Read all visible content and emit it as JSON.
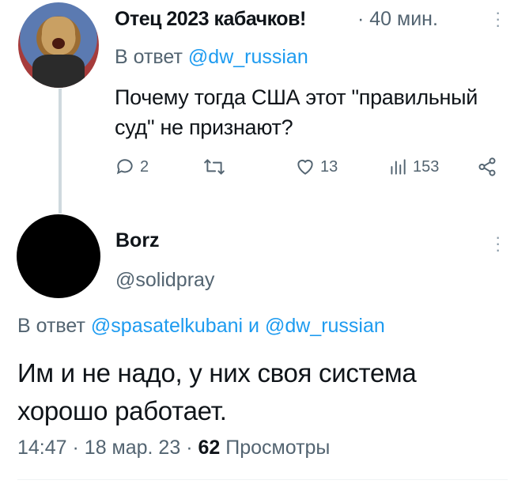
{
  "colors": {
    "accent": "#1d9bf0",
    "secondary": "#536471",
    "text": "#0f1419"
  },
  "tweet1": {
    "author_name": "Отец 2023 кабачков!",
    "time": "· 40 мин.",
    "more_icon": "more-dots-icon",
    "reply_prefix": "В ответ",
    "reply_handle": "@dw_russian",
    "text": "Почему тогда США этот \"правильный суд\" не признают?",
    "actions": {
      "replies": "2",
      "retweets": "",
      "likes": "13",
      "views": "153"
    }
  },
  "tweet2": {
    "author_name": "Borz",
    "handle": "@solidpray",
    "reply_prefix": "В ответ",
    "reply_handle1": "@spasatelkubani",
    "reply_and": "и",
    "reply_handle2": "@dw_russian",
    "text": "Им и не надо, у них своя система хорошо работает.",
    "time": "14:47",
    "date": "18 мар. 23",
    "views_count": "62",
    "views_label": "Просмотры"
  }
}
